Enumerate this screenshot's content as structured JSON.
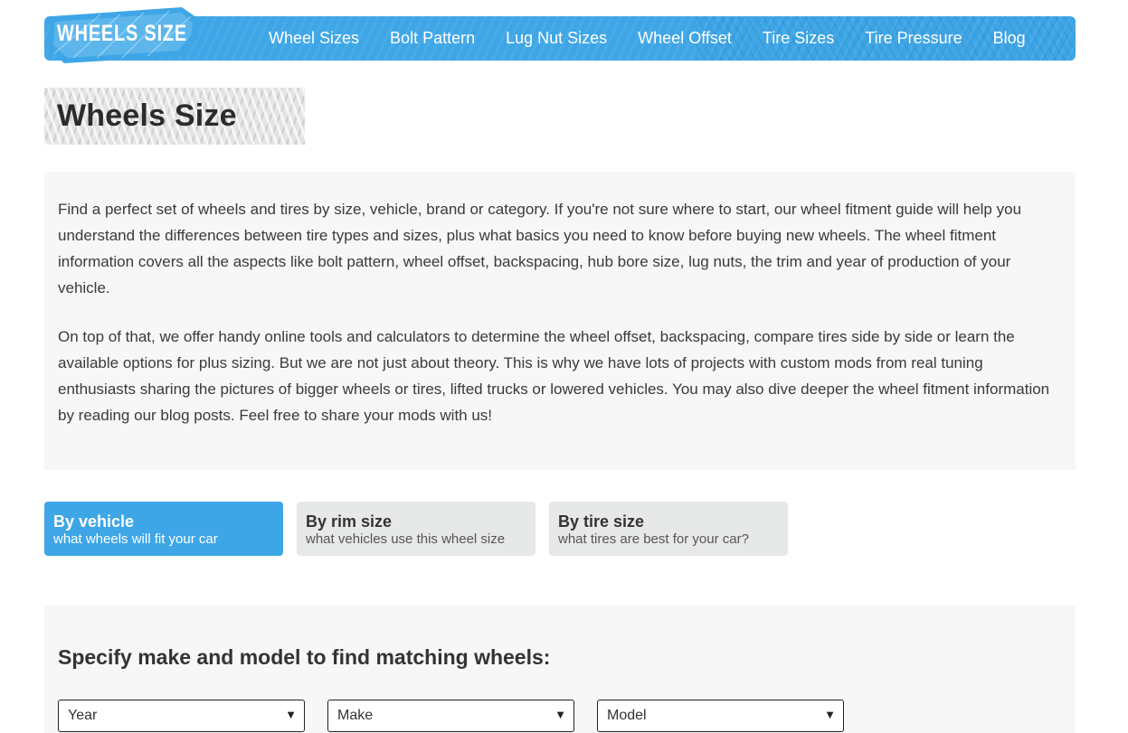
{
  "brand": {
    "logo_text": "WHEELS SIZE",
    "accent": "#3ea6e6",
    "background": "#ffffff",
    "panel_bg": "#f7f7f7"
  },
  "nav": {
    "items": [
      {
        "label": "Wheel Sizes"
      },
      {
        "label": "Bolt Pattern"
      },
      {
        "label": "Lug Nut Sizes"
      },
      {
        "label": "Wheel Offset"
      },
      {
        "label": "Tire Sizes"
      },
      {
        "label": "Tire Pressure"
      },
      {
        "label": "Blog"
      }
    ]
  },
  "page": {
    "title": "Wheels Size"
  },
  "intro": {
    "paragraph1": "Find a perfect set of wheels and tires by size, vehicle, brand or category. If you're not sure where to start, our wheel fitment guide will help you understand the differences between tire types and sizes, plus what basics you need to know before buying new wheels. The wheel fitment information covers all the aspects like bolt pattern, wheel offset, backspacing, hub bore size, lug nuts, the trim and year of production of your vehicle.",
    "paragraph2": "On top of that, we offer handy online tools and calculators to determine the wheel offset, backspacing, compare tires side by side or learn the available options for plus sizing. But we are not just about theory. This is why we have lots of projects with custom mods from real tuning enthusiasts sharing the pictures of bigger wheels or tires, lifted trucks or lowered vehicles. You may also dive deeper the wheel fitment information by reading our blog posts. Feel free to share your mods with us!"
  },
  "tabs": [
    {
      "title": "By vehicle",
      "subtitle": "what wheels will fit your car",
      "active": true
    },
    {
      "title": "By rim size",
      "subtitle": "what vehicles use this wheel size",
      "active": false
    },
    {
      "title": "By tire size",
      "subtitle": "what tires are best for your car?",
      "active": false
    }
  ],
  "search": {
    "heading": "Specify make and model to find matching wheels:",
    "selects": [
      {
        "value": "Year",
        "arrow_icon": "triangle-down-icon"
      },
      {
        "value": "Make",
        "arrow_icon": "triangle-down-icon"
      },
      {
        "value": "Model",
        "arrow_icon": "triangle-down-icon"
      }
    ],
    "arrow_glyph": "▼"
  }
}
